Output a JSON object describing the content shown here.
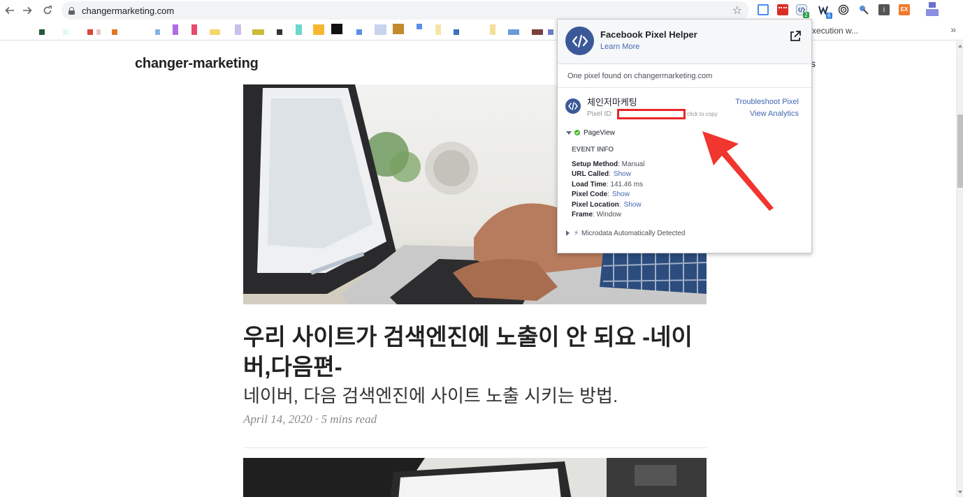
{
  "browser": {
    "url": "changermarketing.com",
    "bookmark_overflow_text": "xecution w...",
    "more": "»",
    "extension_badges": {
      "pixel_helper": "2",
      "wappalyzer": "6",
      "ex_label": "EX",
      "i_label": "I"
    }
  },
  "page": {
    "site_title": "changer-marketing",
    "nav_fragment": "s",
    "post": {
      "title": "우리 사이트가 검색엔진에 노출이 안 되요 -네이버,다음편-",
      "subtitle": "네이버, 다음 검색엔진에 사이트 노출 시키는 방법.",
      "meta": "April 14, 2020 · 5 mins read"
    }
  },
  "popup": {
    "title": "Facebook Pixel Helper",
    "learn_more": "Learn More",
    "found_text": "One pixel found on changermarketing.com",
    "pixel": {
      "name": "체인저마케팅",
      "id_label": "Pixel ID:",
      "copy_hint": "click to copy",
      "troubleshoot": "Troubleshoot Pixel",
      "analytics": "View Analytics"
    },
    "event": {
      "name": "PageView",
      "info_heading": "EVENT INFO",
      "fields": [
        {
          "key": "Setup Method",
          "value": "Manual",
          "link": ""
        },
        {
          "key": "URL Called",
          "value": "",
          "link": "Show"
        },
        {
          "key": "Load Time",
          "value": "141.46 ms",
          "link": ""
        },
        {
          "key": "Pixel Code",
          "value": "",
          "link": "Show"
        },
        {
          "key": "Pixel Location",
          "value": "",
          "link": "Show"
        },
        {
          "key": "Frame",
          "value": "Window",
          "link": ""
        }
      ]
    },
    "microdata": "Microdata Automatically Detected"
  },
  "colors": {
    "facebook_blue": "#3b5998",
    "link_blue": "#4267b2",
    "arrow_red": "#f0362e",
    "highlight_red": "#e8252a",
    "ok_green": "#42b72a"
  }
}
